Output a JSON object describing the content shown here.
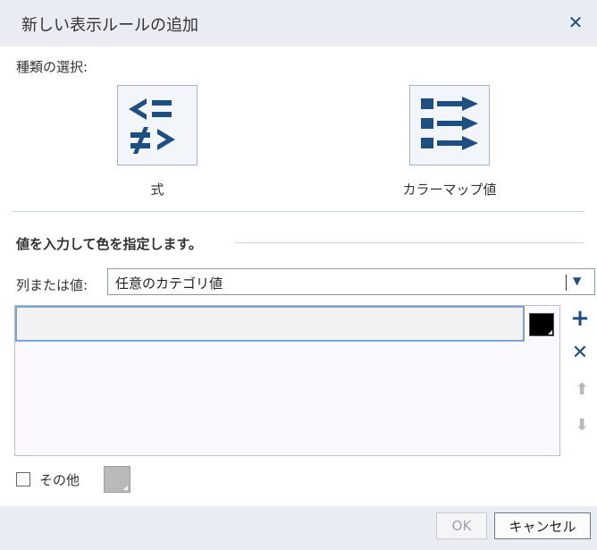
{
  "dialog": {
    "title": "新しい表示ルールの追加",
    "close_icon": "close-icon"
  },
  "rule_type": {
    "label": "種類の選択:",
    "options": [
      {
        "label": "式",
        "icon": "expression-icon"
      },
      {
        "label": "カラーマップ値",
        "icon": "color-map-icon"
      }
    ]
  },
  "value_section": {
    "title": "値を入力して色を指定します。",
    "column_label": "列または値:",
    "column_select_value": "任意のカテゴリ値",
    "value_input": "",
    "value_color": "#000000"
  },
  "list_buttons": {
    "add_icon": "plus-icon",
    "delete_icon": "close-icon",
    "up_icon": "arrow-up-icon",
    "down_icon": "arrow-down-icon"
  },
  "other": {
    "label": "その他",
    "checked": false,
    "color": "#b9b9b9"
  },
  "footer": {
    "ok_label": "OK",
    "cancel_label": "キャンセル"
  },
  "colors": {
    "accent": "#1e4f82",
    "header_bg": "#e9ecf2"
  }
}
